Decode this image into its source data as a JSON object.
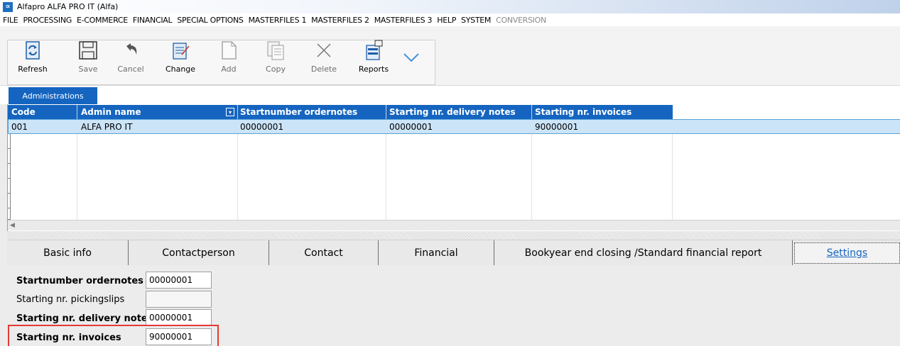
{
  "window": {
    "logo": "∝",
    "title": "Alfapro ALFA PRO IT (Alfa)"
  },
  "menu": [
    {
      "label": "FILE",
      "enabled": true
    },
    {
      "label": "PROCESSING",
      "enabled": true
    },
    {
      "label": "E-COMMERCE",
      "enabled": true
    },
    {
      "label": "FINANCIAL",
      "enabled": true
    },
    {
      "label": "SPECIAL OPTIONS",
      "enabled": true
    },
    {
      "label": "MASTERFILES 1",
      "enabled": true
    },
    {
      "label": "MASTERFILES 2",
      "enabled": true
    },
    {
      "label": "MASTERFILES 3",
      "enabled": true
    },
    {
      "label": "HELP",
      "enabled": true
    },
    {
      "label": "SYSTEM",
      "enabled": true
    },
    {
      "label": "CONVERSION",
      "enabled": false
    }
  ],
  "toolbar": {
    "refresh": "Refresh",
    "save": "Save",
    "cancel": "Cancel",
    "change": "Change",
    "add": "Add",
    "copy": "Copy",
    "delete": "Delete",
    "reports": "Reports"
  },
  "tabs": {
    "administrations": "Administrations"
  },
  "grid": {
    "columns": [
      "Code",
      "Admin name",
      "Startnumber ordernotes",
      "Starting nr. delivery notes",
      "Starting nr. invoices"
    ],
    "rows": [
      [
        "001",
        "ALFA PRO IT",
        "00000001",
        "00000001",
        "90000001"
      ]
    ]
  },
  "detail_tabs": [
    {
      "label": "Basic info",
      "active": false
    },
    {
      "label": "Contactperson",
      "active": false
    },
    {
      "label": "Contact",
      "active": false
    },
    {
      "label": "Financial",
      "active": false
    },
    {
      "label": "Bookyear end closing /Standard financial report",
      "active": false
    },
    {
      "label": "Settings",
      "active": true
    }
  ],
  "settings_form": [
    {
      "label": "Startnumber ordernotes",
      "value": "00000001",
      "bold": true
    },
    {
      "label": "Starting nr. pickingslips",
      "value": "",
      "bold": false
    },
    {
      "label": "Starting nr. delivery notes",
      "value": "00000001",
      "bold": true
    },
    {
      "label": "Starting nr. invoices",
      "value": "90000001",
      "bold": true
    }
  ],
  "colors": {
    "accent": "#1565c0",
    "selected_row": "#cce4f7",
    "highlight_box": "#e53935"
  }
}
